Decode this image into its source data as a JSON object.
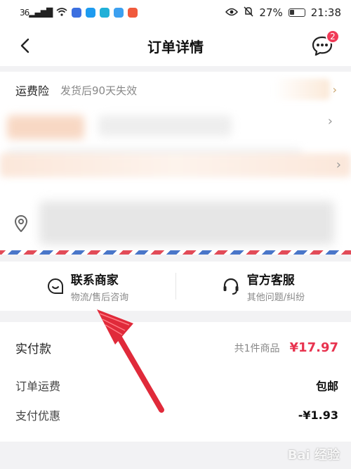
{
  "status_bar": {
    "network": "36",
    "time": "21:38",
    "battery": "27%"
  },
  "header": {
    "title": "订单详情",
    "message_badge": "2"
  },
  "insurance": {
    "label": "运费险",
    "note": "发货后90天失效"
  },
  "contact": {
    "merchant": {
      "label": "联系商家",
      "sub": "物流/售后咨询"
    },
    "service": {
      "label": "官方客服",
      "sub": "其他问题/纠纷"
    }
  },
  "payment": {
    "paid_label": "实付款",
    "item_count": "共1件商品",
    "total": "¥17.97",
    "shipping_label": "订单运费",
    "shipping_value": "包邮",
    "discount_label": "支付优惠",
    "discount_value": "-¥1.93"
  },
  "watermark": "Bai 经验",
  "colors": {
    "accent": "#e8334f",
    "badge": "#f03b57",
    "stripe_red": "#e24b58",
    "stripe_blue": "#4a76c9"
  }
}
